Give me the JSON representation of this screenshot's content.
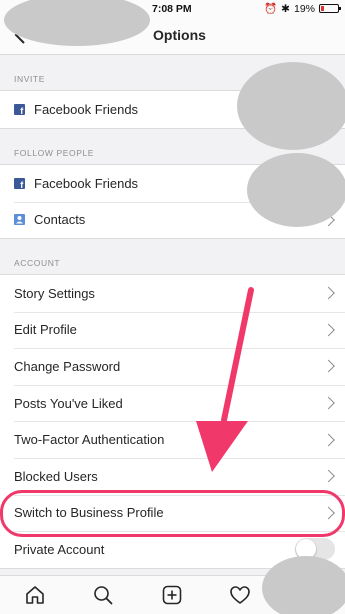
{
  "status_bar": {
    "carrier_placeholder": "",
    "time": "7:08 PM",
    "battery_percent": "19%",
    "battery_level": 0.19
  },
  "nav": {
    "title": "Options",
    "back_icon": "chevron-left-icon"
  },
  "sections": [
    {
      "header": "INVITE",
      "items": [
        {
          "label": "Facebook Friends",
          "icon": "facebook-icon"
        }
      ]
    },
    {
      "header": "FOLLOW PEOPLE",
      "items": [
        {
          "label": "Facebook Friends",
          "icon": "facebook-icon"
        },
        {
          "label": "Contacts",
          "icon": "contacts-icon"
        }
      ]
    },
    {
      "header": "ACCOUNT",
      "items": [
        {
          "label": "Story Settings"
        },
        {
          "label": "Edit Profile"
        },
        {
          "label": "Change Password"
        },
        {
          "label": "Posts You've Liked"
        },
        {
          "label": "Two-Factor Authentication"
        },
        {
          "label": "Blocked Users"
        },
        {
          "label": "Switch to Business Profile"
        },
        {
          "label": "Private Account",
          "toggle": false
        }
      ]
    }
  ],
  "tab_bar": {
    "icons": [
      "home-icon",
      "search-icon",
      "add-post-icon",
      "heart-icon",
      "profile-icon"
    ]
  },
  "colors": {
    "accent": "#f0386b",
    "facebook": "#3b5998",
    "contacts": "#5b8fd6"
  }
}
